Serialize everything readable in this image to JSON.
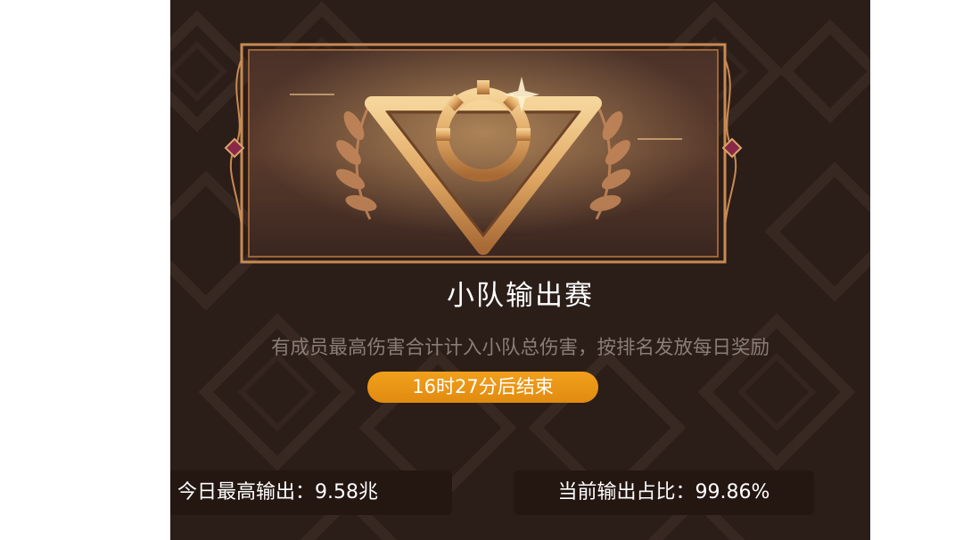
{
  "event": {
    "title": "小队输出赛",
    "description": "有成员最高伤害合计计入小队总伤害，按排名发放每日奖励",
    "timer": "16时27分后结束"
  },
  "stats": {
    "today_max_output": "今日最高输出：9.58兆",
    "current_output_share": "当前输出占比：99.86%"
  },
  "colors": {
    "panel_bg": "#2b1e19",
    "accent_gold": "#d9a56a",
    "timer_orange": "#ef9a18",
    "stat_box_bg": "#241712"
  },
  "icons": {
    "emblem": "gear-triangle-emblem-icon",
    "laurel": "laurel-wreath-icon",
    "gem": "gem-icon"
  }
}
